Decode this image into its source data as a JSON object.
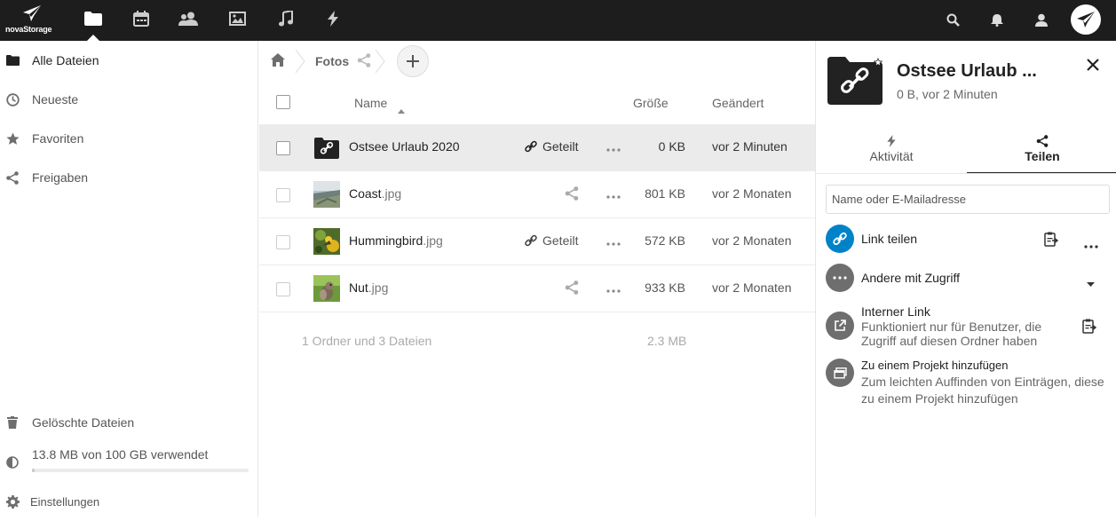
{
  "brand": {
    "name": "novaStorage"
  },
  "topbar": {
    "apps": [
      "files-icon",
      "calendar-icon",
      "contacts-icon",
      "photos-icon",
      "music-icon",
      "activity-icon"
    ],
    "right_icons": [
      "search-icon",
      "notifications-icon",
      "contacts-menu-icon",
      "user-avatar"
    ]
  },
  "sidebar": {
    "items": [
      {
        "label": "Alle Dateien",
        "icon": "folder-icon",
        "active": true
      },
      {
        "label": "Neueste",
        "icon": "clock-icon"
      },
      {
        "label": "Favoriten",
        "icon": "star-icon"
      },
      {
        "label": "Freigaben",
        "icon": "share-icon"
      }
    ],
    "trash": {
      "label": "Gelöschte Dateien",
      "icon": "trash-icon"
    },
    "quota": {
      "label": "13.8 MB von 100 GB verwendet",
      "percent": 0.014
    },
    "settings": {
      "label": "Einstellungen",
      "icon": "gear-icon"
    }
  },
  "breadcrumb": {
    "current": "Fotos"
  },
  "files": {
    "headers": {
      "name": "Name",
      "size": "Größe",
      "modified": "Geändert"
    },
    "rows": [
      {
        "base": "Ostsee Urlaub 2020",
        "ext": "",
        "type": "shared-folder",
        "shared_label": "Geteilt",
        "size": "0 KB",
        "modified": "vor 2 Minuten",
        "selected": true
      },
      {
        "base": "Coast",
        "ext": ".jpg",
        "type": "image",
        "shared_label": "",
        "size": "801 KB",
        "modified": "vor 2 Monaten"
      },
      {
        "base": "Hummingbird",
        "ext": ".jpg",
        "type": "image",
        "shared_label": "Geteilt",
        "size": "572 KB",
        "modified": "vor 2 Monaten"
      },
      {
        "base": "Nut",
        "ext": ".jpg",
        "type": "image",
        "shared_label": "",
        "size": "933 KB",
        "modified": "vor 2 Monaten"
      }
    ],
    "summary": {
      "count": "1 Ordner und 3 Dateien",
      "total": "2.3 MB"
    }
  },
  "panel": {
    "title": "Ostsee Urlaub ...",
    "subtitle": "0 B, vor 2 Minuten",
    "tabs": [
      {
        "label": "Aktivität",
        "icon": "activity-icon"
      },
      {
        "label": "Teilen",
        "icon": "share-icon",
        "active": true
      }
    ],
    "search_placeholder": "Name oder E-Mailadresse",
    "link_share": {
      "label": "Link teilen"
    },
    "others": {
      "label": "Andere mit Zugriff"
    },
    "internal_link": {
      "label": "Interner Link",
      "desc1": "Funktioniert nur für Benutzer, die",
      "desc2": "Zugriff auf diesen Ordner haben"
    },
    "project": {
      "label": "Zu einem Projekt hinzufügen",
      "desc1": "Zum leichten Auffinden von Einträgen, diese",
      "desc2": "zu einem Projekt hinzufügen"
    }
  },
  "colors": {
    "topbar": "#1d1d1d",
    "accent": "#0082c9",
    "selected_row": "#ebebeb",
    "grey_icon": "#6e6e6e"
  }
}
